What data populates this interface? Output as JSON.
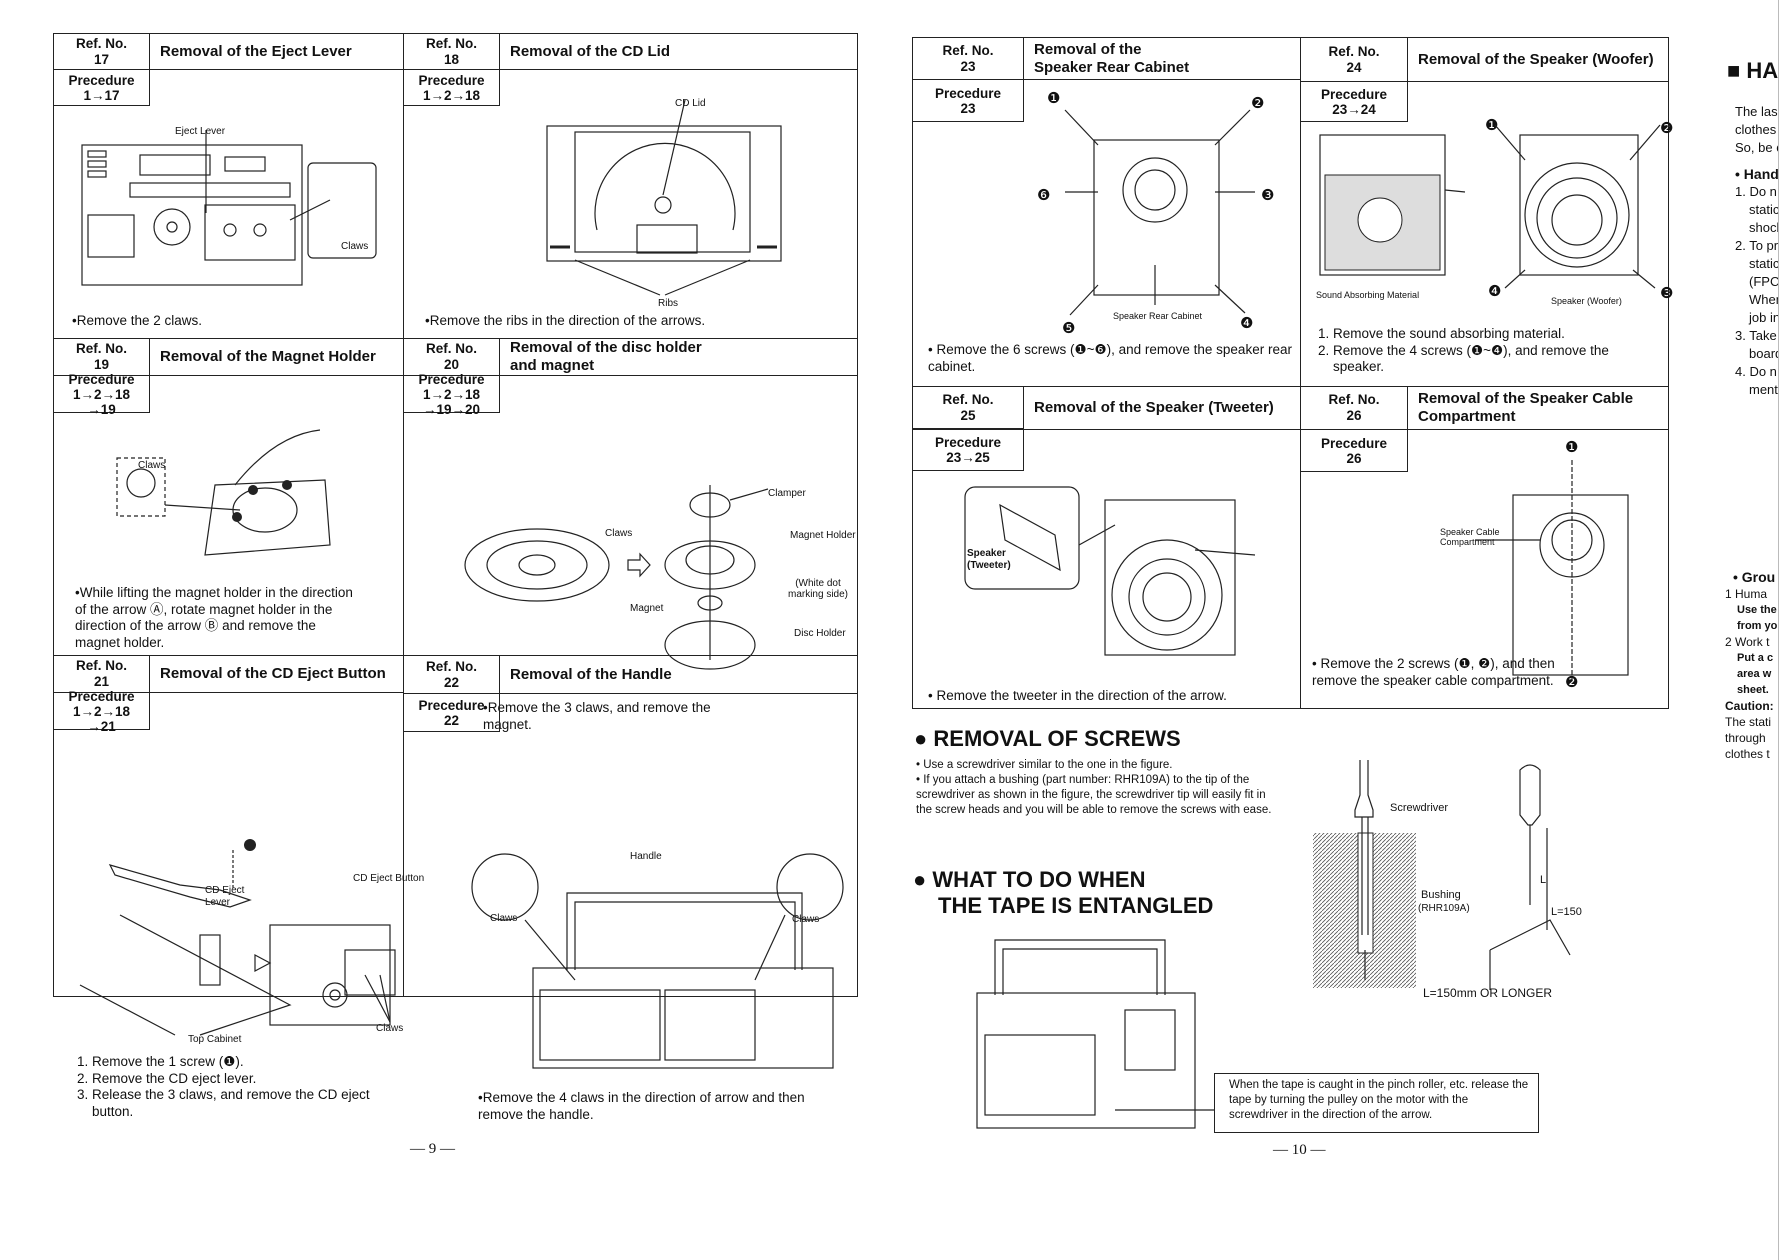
{
  "labels": {
    "ref_no": "Ref. No.",
    "procedure": "Precedure"
  },
  "page_left": {
    "page_number": "— 9 —",
    "sections": [
      {
        "ref": "17",
        "title": "Removal of the Eject Lever",
        "procedure": [
          "1→17"
        ],
        "callouts": [
          "Eject Lever",
          "Claws"
        ],
        "note": "•Remove the 2 claws."
      },
      {
        "ref": "18",
        "title": "Removal of the CD Lid",
        "procedure": [
          "1→2→18"
        ],
        "callouts": [
          "CD Lid",
          "Ribs"
        ],
        "note": "•Remove the ribs in the direction of the arrows."
      },
      {
        "ref": "19",
        "title": "Removal of the Magnet Holder",
        "procedure": [
          "1→2→18",
          "→19"
        ],
        "callouts": [
          "Claws"
        ],
        "note": "•While lifting the magnet holder in the direction of the arrow Ⓐ, rotate magnet holder in the direction of the arrow Ⓑ and remove the magnet holder."
      },
      {
        "ref": "20",
        "title": "Removal of the disc holder and magnet",
        "procedure": [
          "1→2→18",
          "→19→20"
        ],
        "callouts": [
          "Clamper",
          "Claws",
          "Magnet Holder",
          "(White dot marking side)",
          "Magnet",
          "Disc Holder"
        ],
        "note": "•Remove the 3 claws, and remove the magnet."
      },
      {
        "ref": "21",
        "title": "Removal of the CD Eject Button",
        "procedure": [
          "1→2→18",
          "→21"
        ],
        "callouts": [
          "CD Eject Lever",
          "CD Eject Button",
          "Claws",
          "Top Cabinet"
        ],
        "steps": [
          "Remove the 1 screw (❶).",
          "Remove the CD eject lever.",
          "Release the 3 claws, and remove the CD eject button."
        ]
      },
      {
        "ref": "22",
        "title": "Removal of the Handle",
        "procedure": [
          "22"
        ],
        "callouts": [
          "Handle",
          "Claws",
          "Claws"
        ],
        "note": "•Remove the 4 claws in the direction of arrow and then remove the handle."
      }
    ]
  },
  "page_right": {
    "page_number": "— 10 —",
    "sections": [
      {
        "ref": "23",
        "title": "Removal of the Speaker Rear Cabinet",
        "procedure": [
          "23"
        ],
        "callouts": [
          "❶",
          "❷",
          "❸",
          "❹",
          "❺",
          "❻",
          "Speaker Rear Cabinet"
        ],
        "note": "• Remove the 6 screws (❶~❻), and remove the speaker rear cabinet."
      },
      {
        "ref": "24",
        "title": "Removal of the Speaker (Woofer)",
        "procedure": [
          "23→24"
        ],
        "callouts": [
          "Sound Absorbing Material",
          "Speaker (Woofer)",
          "❶",
          "❷",
          "❸",
          "❹"
        ],
        "steps": [
          "Remove the sound absorbing material.",
          "Remove the 4 screws (❶~❹), and remove the speaker."
        ]
      },
      {
        "ref": "25",
        "title": "Removal of the Speaker (Tweeter)",
        "procedure": [
          "23→25"
        ],
        "callouts": [
          "Speaker (Tweeter)"
        ],
        "note": "• Remove the tweeter in the direction of the arrow."
      },
      {
        "ref": "26",
        "title": "Removal of the Speaker Cable Compartment",
        "procedure": [
          "26"
        ],
        "callouts": [
          "Speaker Cable Compartment",
          "❶",
          "❷"
        ],
        "note": "• Remove the 2 screws (❶, ❷), and then remove the speaker cable compartment."
      }
    ],
    "removal_of_screws": {
      "heading": "● REMOVAL OF SCREWS",
      "bullets": [
        "• Use a screwdriver similar to the one in the figure.",
        "• If you attach a bushing (part number: RHR109A) to the tip of the screwdriver as shown in the figure, the screwdriver tip will easily fit in the screw heads and you will be able to remove the screws with ease."
      ],
      "callouts": [
        "Screwdriver",
        "Bushing",
        "(RHR109A)",
        "L",
        "L=150",
        "L=150mm OR LONGER"
      ]
    },
    "tape_entangled": {
      "heading_line1": "● WHAT TO DO WHEN",
      "heading_line2": "THE TAPE IS ENTANGLED",
      "note": "When the tape is caught in the pinch roller, etc. release the tape by turning the pulley on the motor with the screwdriver in the direction of the arrow."
    }
  },
  "page_side": {
    "heading": "■ HA",
    "lines": [
      "The las",
      "clothes",
      "So, be c",
      "• Hand",
      "1. Do n",
      "static",
      "shock",
      "2. To pr",
      "static",
      "(FPC",
      "When",
      "job in",
      "3. Take",
      "board",
      "4. Do n",
      "ment)"
    ],
    "lines2": [
      "• Grou",
      "1  Huma",
      "Use the",
      "from yo",
      "2  Work t",
      "Put a c",
      "area w",
      "sheet.",
      "Caution:",
      "The stati",
      "through",
      "clothes t"
    ]
  }
}
